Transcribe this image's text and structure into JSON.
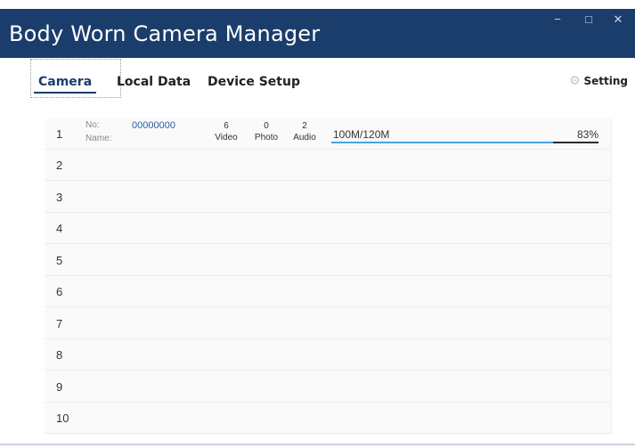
{
  "window": {
    "title": "Body Worn Camera Manager",
    "controls": {
      "minimize": "−",
      "maximize": "□",
      "close": "✕"
    }
  },
  "tabs": [
    {
      "label": "Camera",
      "active": true
    },
    {
      "label": "Local Data",
      "active": false
    },
    {
      "label": "Device Setup",
      "active": false
    }
  ],
  "setting": {
    "icon": "gear-icon",
    "label": "Setting"
  },
  "devices": {
    "rows": [
      "1",
      "2",
      "3",
      "4",
      "5",
      "6",
      "7",
      "8",
      "9",
      "10"
    ],
    "first": {
      "no_label": "No:",
      "no_value": "00000000",
      "name_label": "Name:",
      "video_count": "6",
      "video_label": "Video",
      "photo_count": "0",
      "photo_label": "Photo",
      "audio_count": "2",
      "audio_label": "Audio",
      "storage": "100M/120M",
      "percent": "83%",
      "usage_fraction": 0.83
    }
  },
  "colors": {
    "titlebar": "#1b3d6c",
    "accent": "#4ba3e0"
  }
}
